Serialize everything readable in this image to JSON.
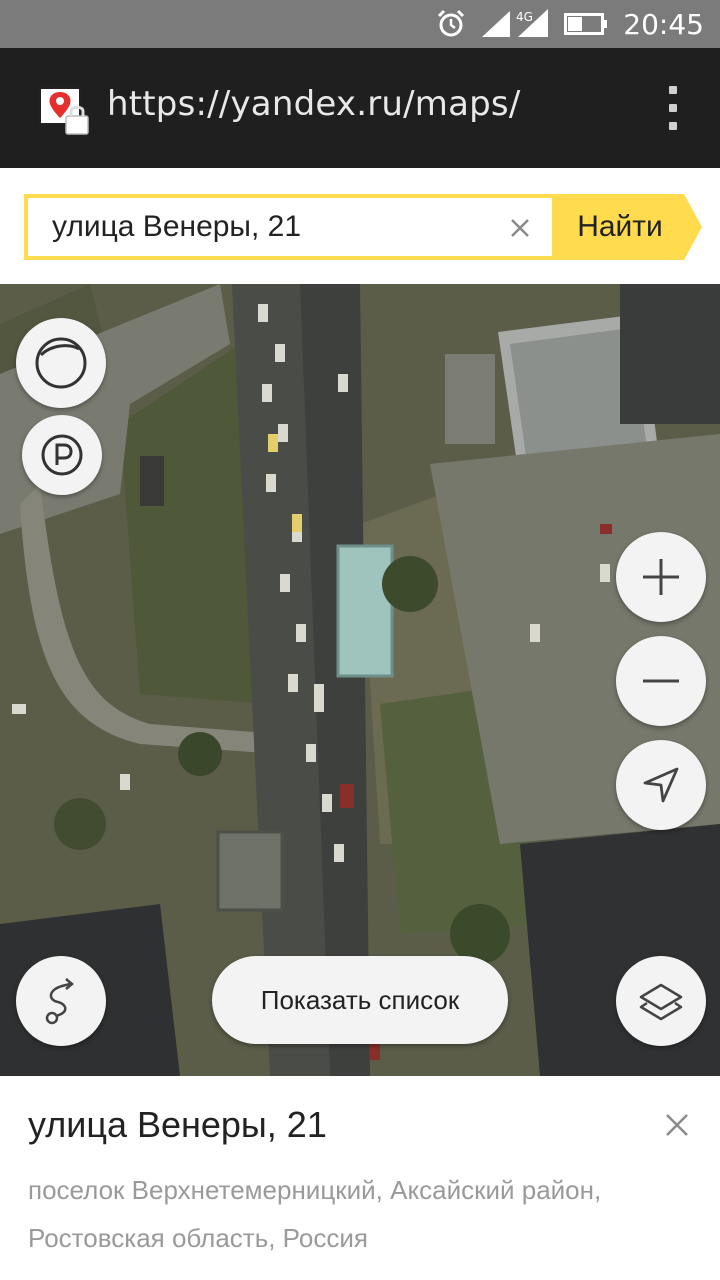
{
  "status_bar": {
    "time": "20:45",
    "network": "4G",
    "icons": [
      "alarm-icon",
      "signal-icon",
      "battery-icon"
    ]
  },
  "browser": {
    "url": "https://yandex.ru/maps/",
    "site_icon": "yandex-maps-lock-icon",
    "menu_icon": "overflow-menu-icon"
  },
  "search": {
    "value": "улица Венеры, 21",
    "placeholder": "",
    "clear_icon": "close-icon",
    "find_label": "Найти"
  },
  "map": {
    "controls_left": [
      "traffic-icon",
      "parking-icon"
    ],
    "controls_right": [
      "zoom-in-icon",
      "zoom-out-icon",
      "my-location-icon"
    ],
    "route_icon": "route-icon",
    "layers_icon": "layers-icon",
    "show_list_label": "Показать список"
  },
  "place": {
    "title": "улица Венеры, 21",
    "address": "поселок Верхнетемерницкий, Аксайский район, Ростовская область, Россия"
  },
  "colors": {
    "accent": "#ffdb4d",
    "browser_bar": "#1f1f1f",
    "status_bar": "#7b7b7b",
    "pin_red": "#e62e2e"
  }
}
